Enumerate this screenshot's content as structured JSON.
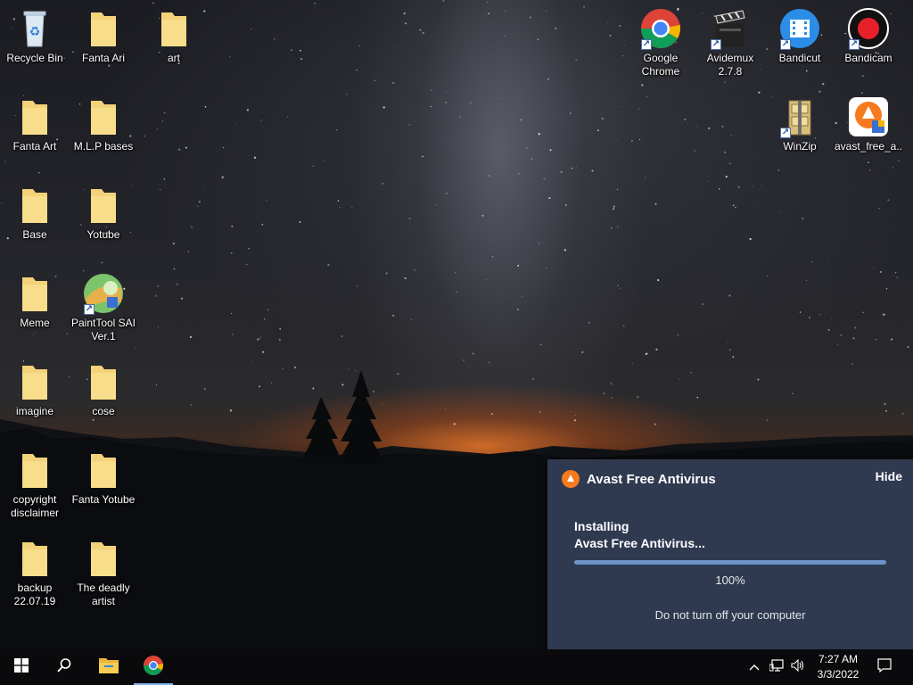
{
  "desktop": {
    "icons_left": [
      {
        "label": "Recycle Bin",
        "icon": "recycle-bin-icon"
      },
      {
        "label": "Fanta Ari",
        "icon": "folder-icon"
      },
      {
        "label": "art",
        "icon": "folder-icon"
      },
      {
        "label": "Fanta Art",
        "icon": "folder-icon"
      },
      {
        "label": "M.L.P bases",
        "icon": "folder-icon"
      },
      {
        "label": "Base",
        "icon": "folder-icon"
      },
      {
        "label": "Yotube",
        "icon": "folder-icon"
      },
      {
        "label": "Meme",
        "icon": "folder-icon"
      },
      {
        "label": "PaintTool SAI Ver.1",
        "icon": "painttool-sai-icon"
      },
      {
        "label": "imagine",
        "icon": "folder-icon"
      },
      {
        "label": "cose",
        "icon": "folder-icon"
      },
      {
        "label": "copyright disclaimer",
        "icon": "folder-icon"
      },
      {
        "label": "Fanta Yotube",
        "icon": "folder-icon"
      },
      {
        "label": "backup 22.07.19",
        "icon": "folder-icon"
      },
      {
        "label": "The deadly artist",
        "icon": "folder-icon"
      }
    ],
    "icons_right": [
      {
        "label": "Google Chrome",
        "icon": "chrome-icon"
      },
      {
        "label": "Avidemux 2.7.8",
        "icon": "avidemux-icon"
      },
      {
        "label": "Bandicut",
        "icon": "bandicut-icon"
      },
      {
        "label": "Bandicam",
        "icon": "bandicam-icon"
      },
      {
        "label": "WinZip",
        "icon": "winzip-icon"
      },
      {
        "label": "avast_free_a...",
        "icon": "avast-installer-icon"
      }
    ]
  },
  "avast_popup": {
    "title": "Avast Free Antivirus",
    "hide_label": "Hide",
    "status_line1": "Installing",
    "status_line2": "Avast Free Antivirus...",
    "progress": 1.0,
    "progress_label": "100%",
    "note": "Do not turn off your computer",
    "accent": "#f77a1d"
  },
  "taskbar": {
    "start_icon": "windows-start-icon",
    "search_icon": "search-icon",
    "pinned": [
      {
        "name": "file-explorer-icon"
      },
      {
        "name": "chrome-icon",
        "active": true
      }
    ],
    "time": "7:27 AM",
    "date": "3/3/2022"
  }
}
